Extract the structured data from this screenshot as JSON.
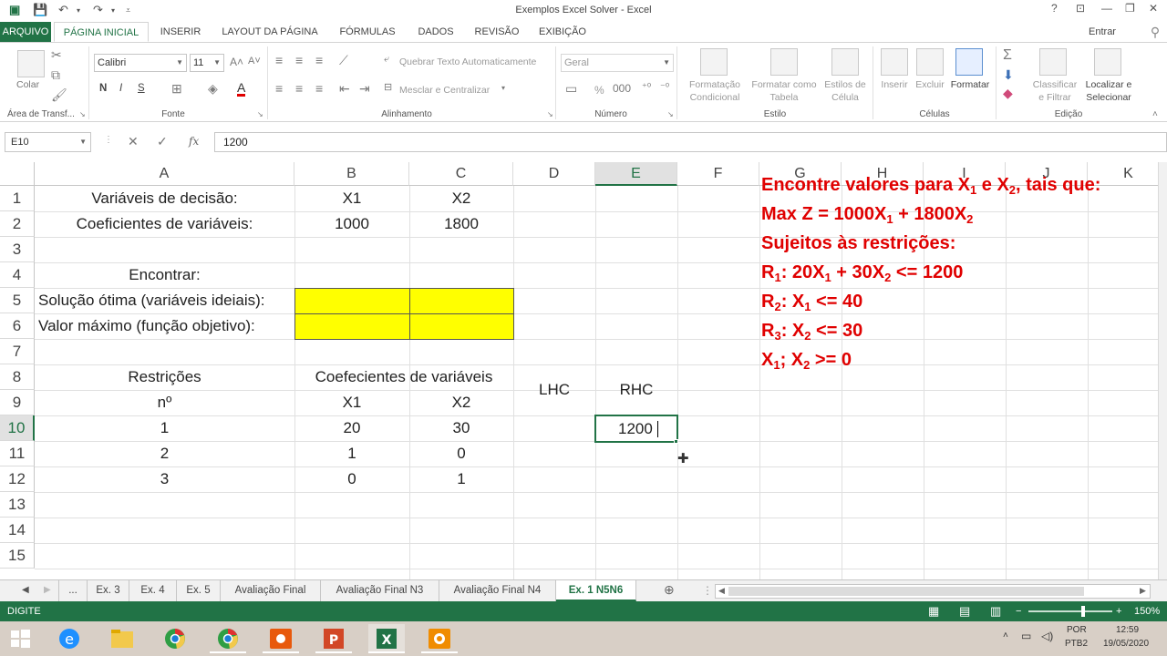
{
  "window": {
    "title": "Exemplos Excel Solver - Excel",
    "help": "?",
    "signin": "Entrar"
  },
  "ribbon": {
    "tabs": [
      "ARQUIVO",
      "PÁGINA INICIAL",
      "INSERIR",
      "LAYOUT DA PÁGINA",
      "FÓRMULAS",
      "DADOS",
      "REVISÃO",
      "EXIBIÇÃO"
    ],
    "clipboard": {
      "paste": "Colar",
      "group": "Área de Transf..."
    },
    "font": {
      "name": "Calibri",
      "size": "11",
      "bold": "N",
      "italic": "I",
      "underline": "S",
      "group": "Fonte"
    },
    "alignment": {
      "wrap": "Quebrar Texto Automaticamente",
      "merge": "Mesclar e Centralizar",
      "group": "Alinhamento"
    },
    "number": {
      "format": "Geral",
      "group": "Número",
      "percent": "%"
    },
    "styles": {
      "cond": "Formatação\nCondicional",
      "table": "Formatar como\nTabela",
      "cell": "Estilos de\nCélula",
      "group": "Estilo",
      "cond1": "Formatação",
      "cond2": "Condicional",
      "table1": "Formatar como",
      "table2": "Tabela",
      "cell1": "Estilos de",
      "cell2": "Célula"
    },
    "cells": {
      "insert": "Inserir",
      "delete": "Excluir",
      "format": "Formatar",
      "group": "Células"
    },
    "editing": {
      "sort1": "Classificar",
      "sort2": "e Filtrar",
      "find1": "Localizar e",
      "find2": "Selecionar",
      "group": "Edição"
    }
  },
  "formula_bar": {
    "name_box": "E10",
    "fx": "fx",
    "value": "1200"
  },
  "columns": [
    "A",
    "B",
    "C",
    "D",
    "E",
    "F",
    "G",
    "H",
    "I",
    "J",
    "K"
  ],
  "rows": [
    "1",
    "2",
    "3",
    "4",
    "5",
    "6",
    "7",
    "8",
    "9",
    "10",
    "11",
    "12",
    "13",
    "14",
    "15"
  ],
  "cells": {
    "A1": "Variáveis de decisão:",
    "B1": "X1",
    "C1": "X2",
    "A2": "Coeficientes de variáveis:",
    "B2": "1000",
    "C2": "1800",
    "A4": "Encontrar:",
    "A5": "Solução ótima (variáveis ideiais):",
    "A6": "Valor máximo (função objetivo):",
    "A8": "Restrições",
    "B8": "Coefecientes de variáveis",
    "A9": "nº",
    "B9": "X1",
    "C9": "X2",
    "D89": "LHC",
    "E89": "RHC",
    "A10": "1",
    "B10": "20",
    "C10": "30",
    "E10": "1200",
    "A11": "2",
    "B11": "1",
    "C11": "0",
    "A12": "3",
    "B12": "0",
    "C12": "1"
  },
  "problem": {
    "l1a": "Encontre valores para X",
    "l1s1": "1",
    "l1b": " e X",
    "l1s2": "2",
    "l1c": ", tais que:",
    "l2a": "Max Z = 1000X",
    "l2s1": "1",
    "l2b": " + 1800X",
    "l2s2": "2",
    "l3": "Sujeitos às restrições:",
    "l4a": "R",
    "l4s0": "1",
    "l4b": ": 20X",
    "l4s1": "1",
    "l4c": " + 30X",
    "l4s2": "2",
    "l4d": " <= 1200",
    "l5a": "R",
    "l5s0": "2",
    "l5b": ":  X",
    "l5s1": "1",
    "l5c": " <= 40",
    "l6a": "R",
    "l6s0": "3",
    "l6b": ": X",
    "l6s2": "2",
    "l6c": " <= 30",
    "l7a": "X",
    "l7s1": "1",
    "l7b": "; X",
    "l7s2": "2",
    "l7c": " >= 0"
  },
  "sheets": [
    "...",
    "Ex. 3",
    "Ex. 4",
    "Ex. 5",
    "Avaliação Final",
    "Avaliação Final N3",
    "Avaliação Final N4",
    "Ex. 1 N5N6"
  ],
  "active_sheet": "Ex. 1 N5N6",
  "status": {
    "mode": "DIGITE",
    "zoom": "150%"
  },
  "taskbar": {
    "lang1": "POR",
    "lang2": "PTB2",
    "time": "12:59",
    "date": "19/05/2020"
  },
  "colors": {
    "excel_green": "#217346",
    "highlight": "#ffff00",
    "problem_red": "#e00000"
  }
}
